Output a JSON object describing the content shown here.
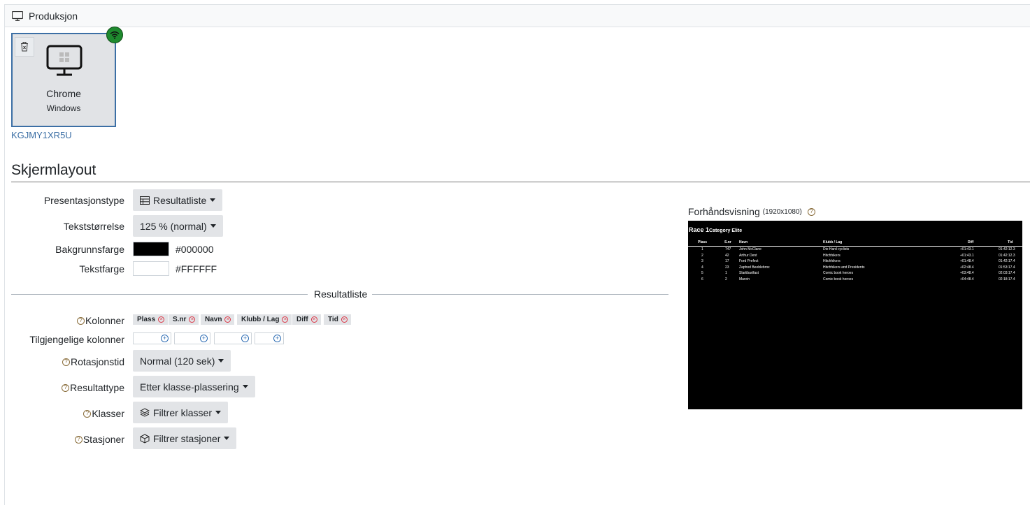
{
  "topbar": {
    "title": "Produksjon",
    "icon": "monitor-icon"
  },
  "device": {
    "name": "Chrome",
    "os": "Windows",
    "id": "KGJMY1XR5U",
    "status_color": "#1e8a2e",
    "status_icon": "wifi-icon"
  },
  "section": {
    "title": "Skjermlayout"
  },
  "form": {
    "presentation_label": "Presentasjonstype",
    "presentation_value": "Resultatliste",
    "text_size_label": "Tekststørrelse",
    "text_size_value": "125 % (normal)",
    "bg_color_label": "Bakgrunnsfarge",
    "bg_color_value": "#000000",
    "text_color_label": "Tekstfarge",
    "text_color_value": "#FFFFFF",
    "subsection_title": "Resultatliste",
    "columns_label": "Kolonner",
    "columns": [
      "Plass",
      "S.nr",
      "Navn",
      "Klubb / Lag",
      "Diff",
      "Tid"
    ],
    "available_columns_label": "Tilgjengelige kolonner",
    "rotation_label": "Rotasjonstid",
    "rotation_value": "Normal (120 sek)",
    "result_type_label": "Resultattype",
    "result_type_value": "Etter klasse-plassering",
    "classes_label": "Klasser",
    "classes_value": "Filtrer klasser",
    "stations_label": "Stasjoner",
    "stations_value": "Filtrer stasjoner"
  },
  "preview": {
    "title": "Forhåndsvisning",
    "resolution": "(1920x1080)",
    "race_title": "Race 1",
    "category": "Category Elite",
    "headers": [
      "Plass",
      "S.nr",
      "Navn",
      "Klubb / Lag",
      "Diff",
      "Tid"
    ],
    "rows": [
      [
        "1",
        "747",
        "John McClane",
        "Die Hard cyclists",
        "+01:43.1",
        "01:42:12.3"
      ],
      [
        "2",
        "42",
        "Arthur Dent",
        "Hitchhikers",
        "+01:43.1",
        "01:42:12.3"
      ],
      [
        "3",
        "17",
        "Ford Prefect",
        "Hitchhikers",
        "+01:48.4",
        "01:42:17.4"
      ],
      [
        "4",
        "23",
        "Zaphod Beeblebrox",
        "Hitchhikers and Presidents",
        "+02:48.4",
        "01:53:17.4"
      ],
      [
        "5",
        "1",
        "Slartibartfast",
        "Comic book heroes",
        "+03:48.4",
        "02:03:17.4"
      ],
      [
        "6",
        "2",
        "Marvin",
        "Comic book heroes",
        "+04:48.4",
        "02:18:17.4"
      ]
    ]
  }
}
